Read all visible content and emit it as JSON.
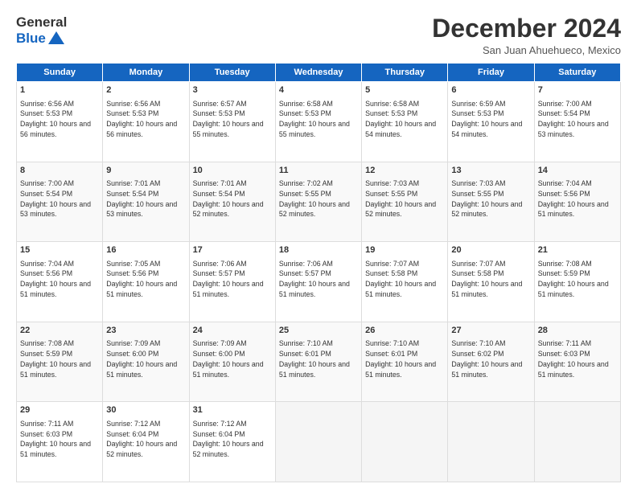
{
  "header": {
    "logo_general": "General",
    "logo_blue": "Blue",
    "month": "December 2024",
    "location": "San Juan Ahuehueco, Mexico"
  },
  "days_of_week": [
    "Sunday",
    "Monday",
    "Tuesday",
    "Wednesday",
    "Thursday",
    "Friday",
    "Saturday"
  ],
  "weeks": [
    [
      {
        "day": "1",
        "detail": "Sunrise: 6:56 AM\nSunset: 5:53 PM\nDaylight: 10 hours\nand 56 minutes."
      },
      {
        "day": "2",
        "detail": "Sunrise: 6:56 AM\nSunset: 5:53 PM\nDaylight: 10 hours\nand 56 minutes."
      },
      {
        "day": "3",
        "detail": "Sunrise: 6:57 AM\nSunset: 5:53 PM\nDaylight: 10 hours\nand 55 minutes."
      },
      {
        "day": "4",
        "detail": "Sunrise: 6:58 AM\nSunset: 5:53 PM\nDaylight: 10 hours\nand 55 minutes."
      },
      {
        "day": "5",
        "detail": "Sunrise: 6:58 AM\nSunset: 5:53 PM\nDaylight: 10 hours\nand 54 minutes."
      },
      {
        "day": "6",
        "detail": "Sunrise: 6:59 AM\nSunset: 5:53 PM\nDaylight: 10 hours\nand 54 minutes."
      },
      {
        "day": "7",
        "detail": "Sunrise: 7:00 AM\nSunset: 5:54 PM\nDaylight: 10 hours\nand 53 minutes."
      }
    ],
    [
      {
        "day": "8",
        "detail": "Sunrise: 7:00 AM\nSunset: 5:54 PM\nDaylight: 10 hours\nand 53 minutes."
      },
      {
        "day": "9",
        "detail": "Sunrise: 7:01 AM\nSunset: 5:54 PM\nDaylight: 10 hours\nand 53 minutes."
      },
      {
        "day": "10",
        "detail": "Sunrise: 7:01 AM\nSunset: 5:54 PM\nDaylight: 10 hours\nand 52 minutes."
      },
      {
        "day": "11",
        "detail": "Sunrise: 7:02 AM\nSunset: 5:55 PM\nDaylight: 10 hours\nand 52 minutes."
      },
      {
        "day": "12",
        "detail": "Sunrise: 7:03 AM\nSunset: 5:55 PM\nDaylight: 10 hours\nand 52 minutes."
      },
      {
        "day": "13",
        "detail": "Sunrise: 7:03 AM\nSunset: 5:55 PM\nDaylight: 10 hours\nand 52 minutes."
      },
      {
        "day": "14",
        "detail": "Sunrise: 7:04 AM\nSunset: 5:56 PM\nDaylight: 10 hours\nand 51 minutes."
      }
    ],
    [
      {
        "day": "15",
        "detail": "Sunrise: 7:04 AM\nSunset: 5:56 PM\nDaylight: 10 hours\nand 51 minutes."
      },
      {
        "day": "16",
        "detail": "Sunrise: 7:05 AM\nSunset: 5:56 PM\nDaylight: 10 hours\nand 51 minutes."
      },
      {
        "day": "17",
        "detail": "Sunrise: 7:06 AM\nSunset: 5:57 PM\nDaylight: 10 hours\nand 51 minutes."
      },
      {
        "day": "18",
        "detail": "Sunrise: 7:06 AM\nSunset: 5:57 PM\nDaylight: 10 hours\nand 51 minutes."
      },
      {
        "day": "19",
        "detail": "Sunrise: 7:07 AM\nSunset: 5:58 PM\nDaylight: 10 hours\nand 51 minutes."
      },
      {
        "day": "20",
        "detail": "Sunrise: 7:07 AM\nSunset: 5:58 PM\nDaylight: 10 hours\nand 51 minutes."
      },
      {
        "day": "21",
        "detail": "Sunrise: 7:08 AM\nSunset: 5:59 PM\nDaylight: 10 hours\nand 51 minutes."
      }
    ],
    [
      {
        "day": "22",
        "detail": "Sunrise: 7:08 AM\nSunset: 5:59 PM\nDaylight: 10 hours\nand 51 minutes."
      },
      {
        "day": "23",
        "detail": "Sunrise: 7:09 AM\nSunset: 6:00 PM\nDaylight: 10 hours\nand 51 minutes."
      },
      {
        "day": "24",
        "detail": "Sunrise: 7:09 AM\nSunset: 6:00 PM\nDaylight: 10 hours\nand 51 minutes."
      },
      {
        "day": "25",
        "detail": "Sunrise: 7:10 AM\nSunset: 6:01 PM\nDaylight: 10 hours\nand 51 minutes."
      },
      {
        "day": "26",
        "detail": "Sunrise: 7:10 AM\nSunset: 6:01 PM\nDaylight: 10 hours\nand 51 minutes."
      },
      {
        "day": "27",
        "detail": "Sunrise: 7:10 AM\nSunset: 6:02 PM\nDaylight: 10 hours\nand 51 minutes."
      },
      {
        "day": "28",
        "detail": "Sunrise: 7:11 AM\nSunset: 6:03 PM\nDaylight: 10 hours\nand 51 minutes."
      }
    ],
    [
      {
        "day": "29",
        "detail": "Sunrise: 7:11 AM\nSunset: 6:03 PM\nDaylight: 10 hours\nand 51 minutes."
      },
      {
        "day": "30",
        "detail": "Sunrise: 7:12 AM\nSunset: 6:04 PM\nDaylight: 10 hours\nand 52 minutes."
      },
      {
        "day": "31",
        "detail": "Sunrise: 7:12 AM\nSunset: 6:04 PM\nDaylight: 10 hours\nand 52 minutes."
      },
      {
        "day": "",
        "detail": ""
      },
      {
        "day": "",
        "detail": ""
      },
      {
        "day": "",
        "detail": ""
      },
      {
        "day": "",
        "detail": ""
      }
    ]
  ]
}
